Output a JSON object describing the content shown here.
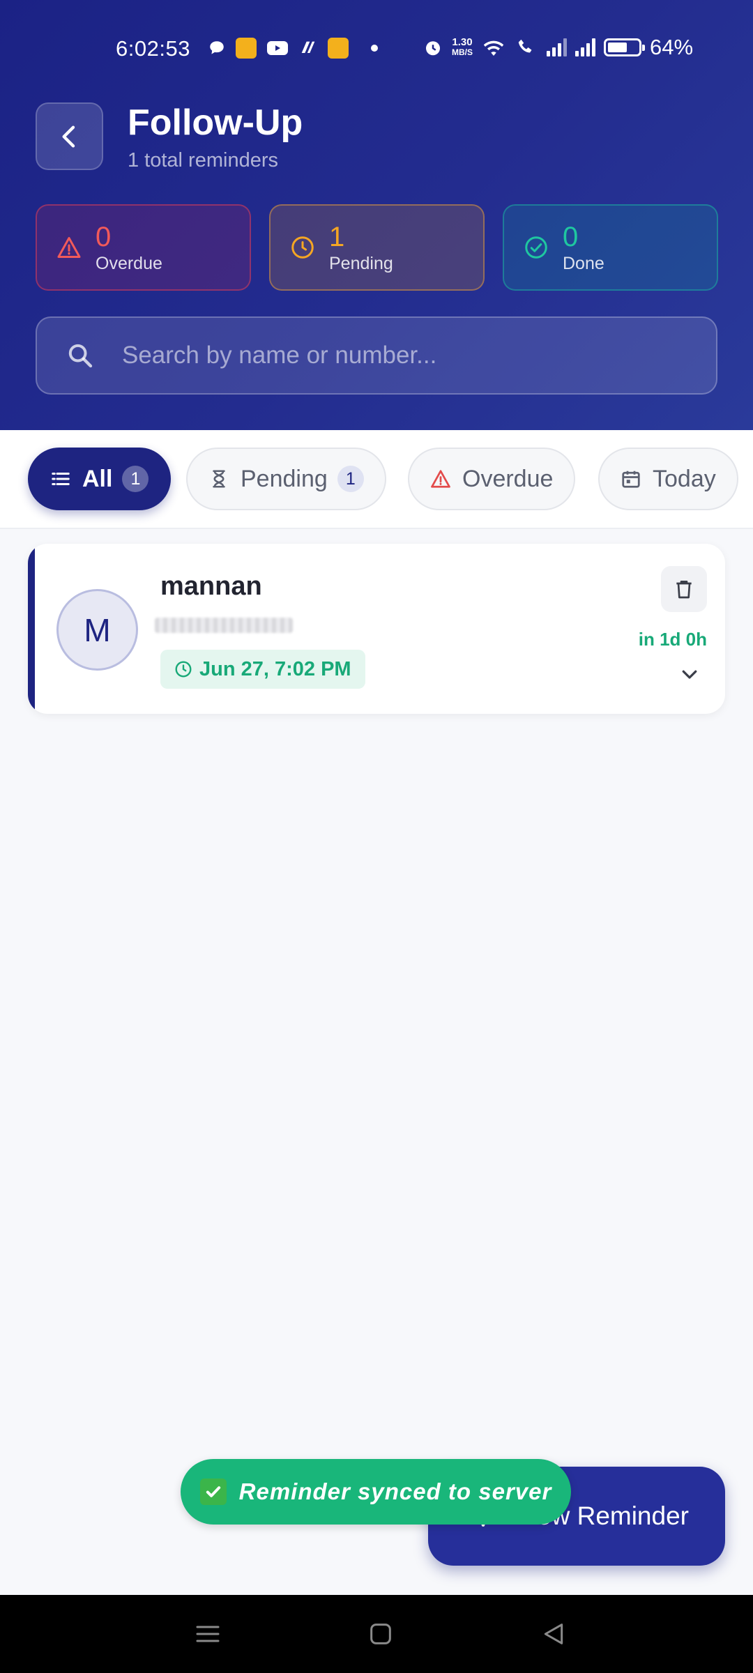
{
  "status_bar": {
    "time": "6:02:53",
    "net_speed_value": "1.30",
    "net_speed_unit": "MB/S",
    "battery": "64%"
  },
  "header": {
    "title": "Follow-Up",
    "subtitle": "1 total reminders"
  },
  "stats": {
    "overdue": {
      "count": "0",
      "label": "Overdue",
      "color": "#f15a5a"
    },
    "pending": {
      "count": "1",
      "label": "Pending",
      "color": "#f5a623"
    },
    "done": {
      "count": "0",
      "label": "Done",
      "color": "#1fc7a0"
    }
  },
  "search": {
    "placeholder": "Search by name or number..."
  },
  "filters": [
    {
      "label": "All",
      "count": "1",
      "icon": "list-icon",
      "active": true
    },
    {
      "label": "Pending",
      "count": "1",
      "icon": "hourglass-icon"
    },
    {
      "label": "Overdue",
      "icon": "warning-icon"
    },
    {
      "label": "Today",
      "icon": "calendar-icon"
    }
  ],
  "reminders": [
    {
      "initial": "M",
      "name": "mannan",
      "datetime": "Jun 27, 7:02 PM",
      "due_in": "in 1d 0h"
    }
  ],
  "fab": {
    "label": "New Reminder"
  },
  "toast": {
    "text": "Reminder synced to server"
  },
  "colors": {
    "brand": "#1e2481",
    "success": "#18a978"
  }
}
